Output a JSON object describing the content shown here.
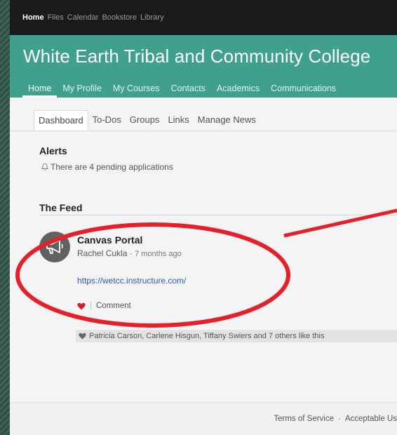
{
  "topbar": {
    "items": [
      "Home",
      "Files",
      "Calendar",
      "Bookstore",
      "Library"
    ]
  },
  "banner": {
    "title": "White Earth Tribal and Community College"
  },
  "mainnav": {
    "items": [
      "Home",
      "My Profile",
      "My Courses",
      "Contacts",
      "Academics",
      "Communications"
    ]
  },
  "subtabs": {
    "items": [
      "Dashboard",
      "To-Dos",
      "Groups",
      "Links",
      "Manage News"
    ]
  },
  "alerts": {
    "title": "Alerts",
    "text": "There are 4 pending applications"
  },
  "feed": {
    "title": "The Feed",
    "post": {
      "title": "Canvas Portal",
      "author": "Rachel Cukla",
      "separator": "·",
      "time": "7 months ago",
      "link": "https://wetcc.instructure.com/",
      "comment_label": "Comment",
      "likes_text": "Patricia Carson, Carlene Hisgun, Tiffany Swiers and 7 others like this"
    }
  },
  "footer": {
    "terms": "Terms of Service",
    "dot": "·",
    "aup": "Acceptable Us"
  },
  "colors": {
    "brand": "#3fa08e",
    "annotation": "#e5202a",
    "heart": "#d0202f",
    "link": "#2b5bb5"
  },
  "icons": {
    "alert": "bell-icon",
    "avatar": "megaphone-icon",
    "like": "heart-icon"
  }
}
